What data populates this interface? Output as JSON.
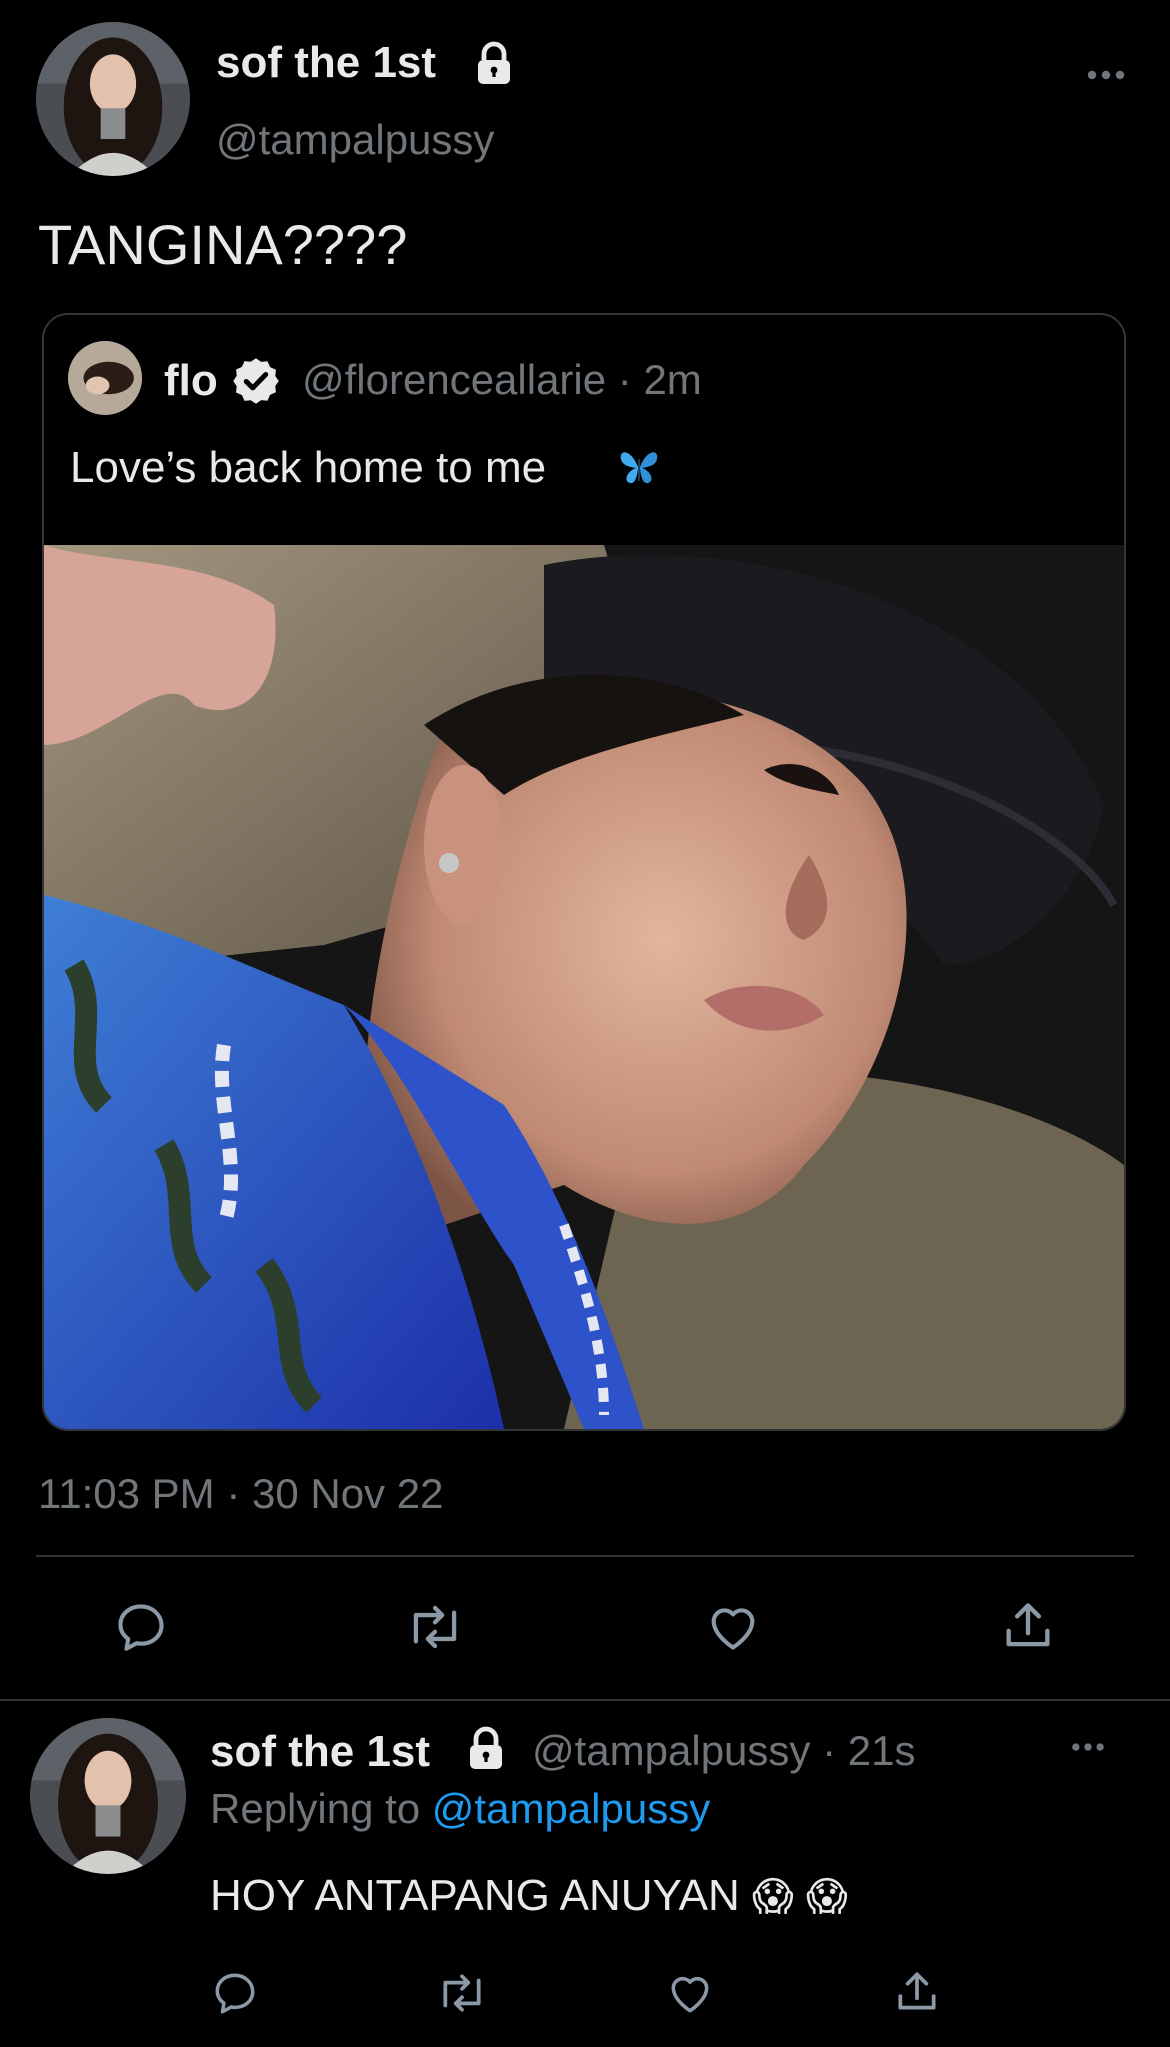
{
  "main_tweet": {
    "display_name": "sof the 1st",
    "handle": "@tampalpussy",
    "text": "TANGINA????",
    "timestamp": "11:03 PM · 30 Nov 22",
    "more_icon": "more-horizontal-icon",
    "lock_icon": "lock-icon"
  },
  "quoted_tweet": {
    "display_name": "flo",
    "handle": "@florenceallarie",
    "time": "· 2m",
    "text": "Love’s back home to me",
    "emoji_icon": "blue-butterfly-icon",
    "verified_icon": "verified-badge-icon"
  },
  "actions": {
    "reply_icon": "reply-icon",
    "retweet_icon": "retweet-icon",
    "like_icon": "heart-icon",
    "share_icon": "share-icon"
  },
  "reply_tweet": {
    "display_name": "sof the 1st",
    "handle": "@tampalpussy",
    "time": "· 21s",
    "replying_prefix": "Replying to",
    "replying_handle": "@tampalpussy",
    "text": "HOY ANTAPANG ANUYAN",
    "emoji_1": "😱",
    "emoji_2": "😱"
  },
  "colors": {
    "background": "#000000",
    "text": "#e7e9ea",
    "muted": "#71767b",
    "link": "#1d9bf0",
    "divider": "#2f3336"
  }
}
